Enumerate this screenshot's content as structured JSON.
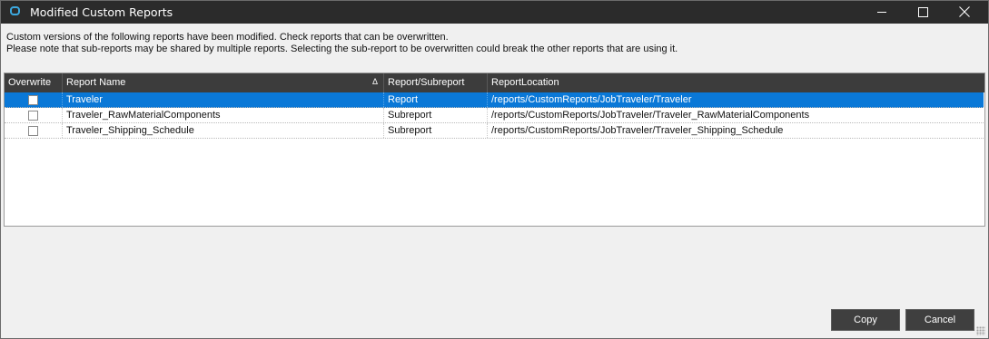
{
  "window": {
    "title": "Modified Custom Reports"
  },
  "message": {
    "line1": "Custom versions of the following reports have been modified. Check reports that can be overwritten.",
    "line2": "Please note that sub-reports may be shared by multiple reports. Selecting the sub-report to be overwritten could break the other reports that are using it."
  },
  "grid": {
    "columns": {
      "overwrite": "Overwrite",
      "report_name": "Report Name",
      "report_type": "Report/Subreport",
      "report_location": "ReportLocation"
    },
    "sort_icon": "sort-ascending-icon",
    "rows": [
      {
        "checked": false,
        "name": "Traveler",
        "type": "Report",
        "location": "/reports/CustomReports/JobTraveler/Traveler",
        "selected": true
      },
      {
        "checked": false,
        "name": "Traveler_RawMaterialComponents",
        "type": "Subreport",
        "location": "/reports/CustomReports/JobTraveler/Traveler_RawMaterialComponents",
        "selected": false
      },
      {
        "checked": false,
        "name": "Traveler_Shipping_Schedule",
        "type": "Subreport",
        "location": "/reports/CustomReports/JobTraveler/Traveler_Shipping_Schedule",
        "selected": false
      }
    ]
  },
  "buttons": {
    "copy": "Copy",
    "cancel": "Cancel"
  },
  "colors": {
    "titlebar": "#2b2b2b",
    "selection": "#0a78d7",
    "header": "#3c3c3c",
    "button": "#3f3f3f",
    "app_icon": "#3ca9e0"
  }
}
